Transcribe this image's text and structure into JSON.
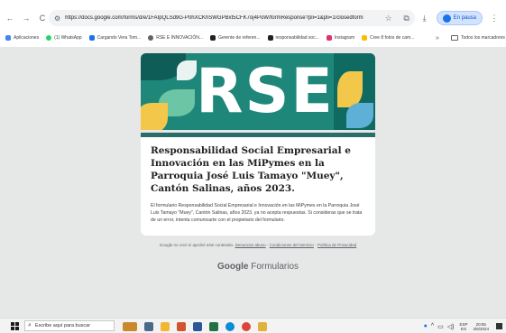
{
  "browser": {
    "nav": {
      "back": "←",
      "forward": "→",
      "reload": "C"
    },
    "url": "https://docs.google.com/forms/d/e/1FAIpQLSd9G-P0hXCKhSWGPBxt5CFK7oj4PoW/formResponse?pli=1&pli=1/closedform",
    "profile_label": "En pausa",
    "bookmarks": [
      {
        "label": "Aplicaciones",
        "color": "#4285f4"
      },
      {
        "label": "(1) WhatsApp",
        "color": "#25d366"
      },
      {
        "label": "Cargando Vera Tom...",
        "color": "#1a73e8"
      },
      {
        "label": "RSE E INNOVACIÓN...",
        "color": "#5f6368"
      },
      {
        "label": "Gerente de referen...",
        "color": "#202124"
      },
      {
        "label": "responsabilidad soc...",
        "color": "#202124"
      },
      {
        "label": "Instagram",
        "color": "#e1306c"
      },
      {
        "label": "Cree 8 fotos de cam...",
        "color": "#fbbc04"
      }
    ],
    "bookmark_folder": "Todos los marcadores",
    "tooltip": "Todos los marcadores"
  },
  "form": {
    "banner_text": "RSE",
    "title": "Responsabilidad Social Empresarial e Innovación en las MiPymes en la Parroquia José Luis Tamayo \"Muey\", Cantón Salinas, años 2023.",
    "message": "El formulario Responsabilidad Social Empresarial e Innovación en las MiPymes en la Parroquia José Luis Tamayo \"Muey\", Cantón Salinas, años 2023. ya no acepta respuestas. Si consideras que se trata de un error, intenta comunicarte con el propietario del formulario.",
    "disclaimer_prefix": "Google no creó ni aprobó este contenido.",
    "report_link": "Denunciar abuso",
    "terms_link": "Condiciones del Servicio",
    "privacy_link": "Política de Privacidad",
    "separator": "-",
    "brand_google": "Google",
    "brand_forms": "Formularios"
  },
  "taskbar": {
    "search_placeholder": "Escribe aquí para buscar",
    "lang_top": "ESP",
    "lang_bottom": "ES",
    "time": "20:55",
    "date": "3/6/2024"
  }
}
